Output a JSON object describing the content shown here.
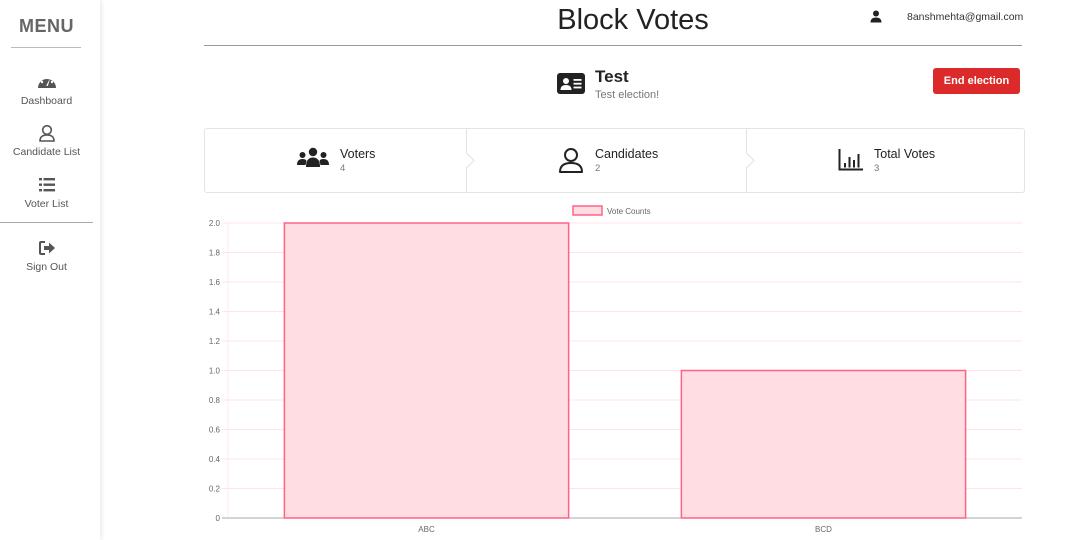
{
  "sidebar": {
    "title": "MENU",
    "items": [
      {
        "label": "Dashboard",
        "icon": "dashboard-gauge-icon"
      },
      {
        "label": "Candidate List",
        "icon": "user-outline-icon"
      },
      {
        "label": "Voter List",
        "icon": "list-icon"
      },
      {
        "label": "Sign Out",
        "icon": "sign-out-icon"
      }
    ]
  },
  "header": {
    "title": "Block Votes",
    "user_email": "8anshmehta@gmail.com",
    "user_icon": "user-icon"
  },
  "election": {
    "name": "Test",
    "description": "Test election!",
    "icon": "id-card-icon",
    "end_button_label": "End election"
  },
  "stats": [
    {
      "label": "Voters",
      "value": "4",
      "icon": "users-icon"
    },
    {
      "label": "Candidates",
      "value": "2",
      "icon": "user-outline-icon"
    },
    {
      "label": "Total Votes",
      "value": "3",
      "icon": "bar-chart-icon"
    }
  ],
  "colors": {
    "accent_red": "#dc2a2a",
    "bar_fill": "#ffdde3",
    "bar_border": "#ff6384"
  },
  "chart_data": {
    "type": "bar",
    "categories": [
      "ABC",
      "BCD"
    ],
    "series": [
      {
        "name": "Vote Counts",
        "values": [
          2,
          1
        ]
      }
    ],
    "legend": [
      "Vote Counts"
    ],
    "legend_position": "top",
    "title": "",
    "xlabel": "",
    "ylabel": "",
    "ylim": [
      0,
      2.0
    ],
    "yticks": [
      "0",
      "0.2",
      "0.4",
      "0.6",
      "0.8",
      "1.0",
      "1.2",
      "1.4",
      "1.6",
      "1.8",
      "2.0"
    ],
    "grid": true
  }
}
